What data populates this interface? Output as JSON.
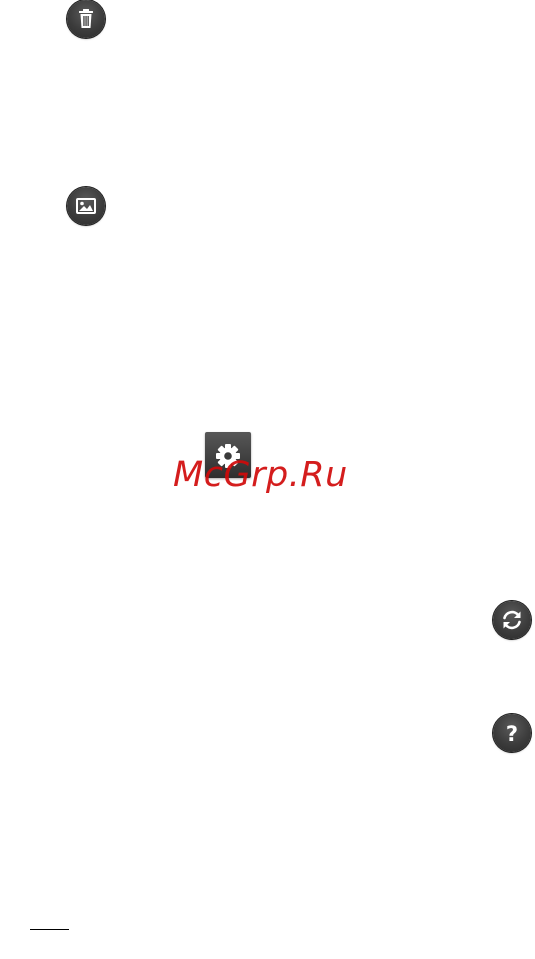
{
  "icons": {
    "delete": "trash-icon",
    "gallery": "picture-icon",
    "settings": "gear-icon",
    "refresh": "refresh-icon",
    "help": "help-icon",
    "help_glyph": "?"
  },
  "watermark": {
    "text": "McGrp.Ru",
    "color": "#d10a0a"
  },
  "colors": {
    "icon_background": "#3c3c3c",
    "icon_glyph": "#ffffff"
  }
}
